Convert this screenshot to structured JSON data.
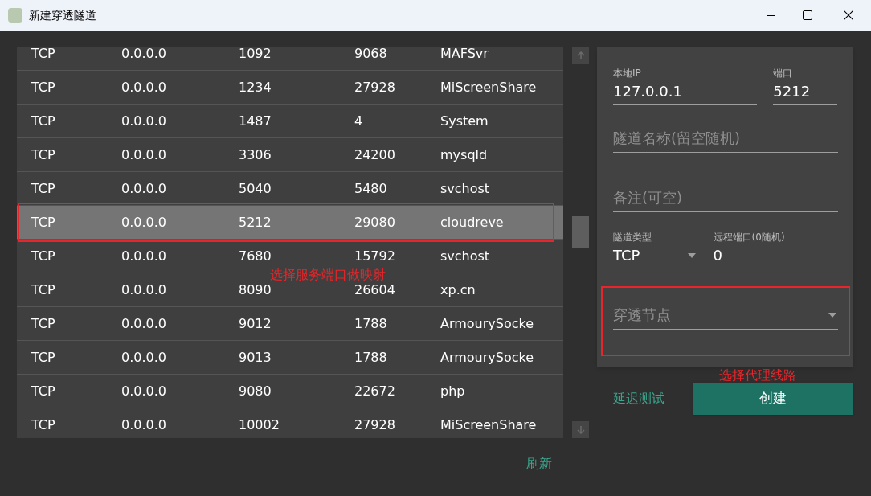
{
  "window": {
    "title": "新建穿透隧道"
  },
  "table": {
    "rows": [
      {
        "cells": [
          "TCP",
          "0.0.0.0",
          "1092",
          "9068",
          "MAFSvr"
        ],
        "selected": false
      },
      {
        "cells": [
          "TCP",
          "0.0.0.0",
          "1234",
          "27928",
          "MiScreenShare"
        ],
        "selected": false
      },
      {
        "cells": [
          "TCP",
          "0.0.0.0",
          "1487",
          "4",
          "System"
        ],
        "selected": false
      },
      {
        "cells": [
          "TCP",
          "0.0.0.0",
          "3306",
          "24200",
          "mysqld"
        ],
        "selected": false
      },
      {
        "cells": [
          "TCP",
          "0.0.0.0",
          "5040",
          "5480",
          "svchost"
        ],
        "selected": false
      },
      {
        "cells": [
          "TCP",
          "0.0.0.0",
          "5212",
          "29080",
          "cloudreve"
        ],
        "selected": true
      },
      {
        "cells": [
          "TCP",
          "0.0.0.0",
          "7680",
          "15792",
          "svchost"
        ],
        "selected": false
      },
      {
        "cells": [
          "TCP",
          "0.0.0.0",
          "8090",
          "26604",
          "xp.cn"
        ],
        "selected": false
      },
      {
        "cells": [
          "TCP",
          "0.0.0.0",
          "9012",
          "1788",
          "ArmourySocke"
        ],
        "selected": false
      },
      {
        "cells": [
          "TCP",
          "0.0.0.0",
          "9013",
          "1788",
          "ArmourySocke"
        ],
        "selected": false
      },
      {
        "cells": [
          "TCP",
          "0.0.0.0",
          "9080",
          "22672",
          "php"
        ],
        "selected": false
      },
      {
        "cells": [
          "TCP",
          "0.0.0.0",
          "10002",
          "27928",
          "MiScreenShare"
        ],
        "selected": false
      }
    ]
  },
  "form": {
    "local_ip": {
      "label": "本地IP",
      "value": "127.0.0.1"
    },
    "port": {
      "label": "端口",
      "value": "5212"
    },
    "tunnel_name": {
      "placeholder": "隧道名称(留空随机)"
    },
    "note": {
      "placeholder": "备注(可空)"
    },
    "tunnel_type": {
      "label": "隧道类型",
      "value": "TCP"
    },
    "remote_port": {
      "label": "远程端口(0随机)",
      "value": "0"
    },
    "node": {
      "placeholder": "穿透节点"
    }
  },
  "latency_test": "延迟测试",
  "create_button": "创建",
  "refresh": "刷新",
  "annotations": [
    "选择服务端口做映射",
    "选择代理线路"
  ]
}
